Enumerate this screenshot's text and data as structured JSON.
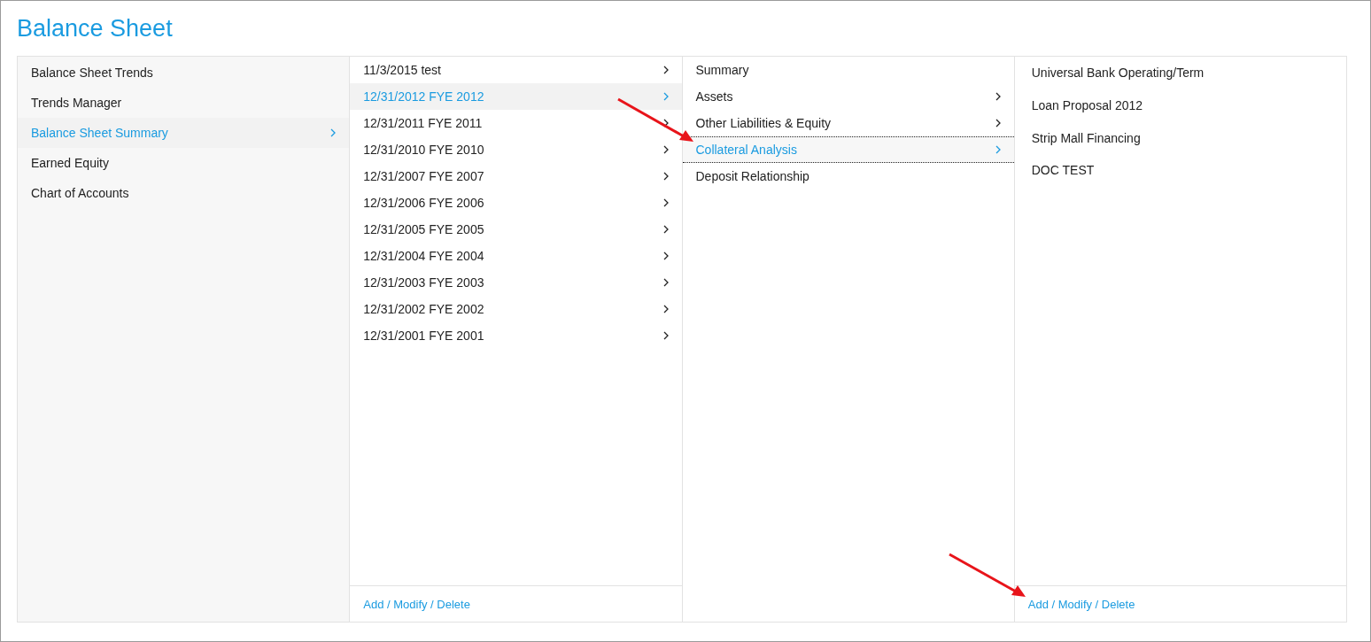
{
  "title": "Balance Sheet",
  "sidebar": {
    "items": [
      {
        "label": "Balance Sheet Trends",
        "selected": false,
        "chevron": false
      },
      {
        "label": "Trends Manager",
        "selected": false,
        "chevron": false
      },
      {
        "label": "Balance Sheet Summary",
        "selected": true,
        "chevron": true
      },
      {
        "label": "Earned Equity",
        "selected": false,
        "chevron": false
      },
      {
        "label": "Chart of Accounts",
        "selected": false,
        "chevron": false
      }
    ]
  },
  "periods": {
    "items": [
      {
        "label": "11/3/2015 test",
        "selected": false,
        "chevron": true
      },
      {
        "label": "12/31/2012 FYE 2012",
        "selected": true,
        "chevron": true
      },
      {
        "label": "12/31/2011 FYE 2011",
        "selected": false,
        "chevron": true
      },
      {
        "label": "12/31/2010 FYE 2010",
        "selected": false,
        "chevron": true
      },
      {
        "label": "12/31/2007 FYE 2007",
        "selected": false,
        "chevron": true
      },
      {
        "label": "12/31/2006 FYE 2006",
        "selected": false,
        "chevron": true
      },
      {
        "label": "12/31/2005 FYE 2005",
        "selected": false,
        "chevron": true
      },
      {
        "label": "12/31/2004 FYE 2004",
        "selected": false,
        "chevron": true
      },
      {
        "label": "12/31/2003 FYE 2003",
        "selected": false,
        "chevron": true
      },
      {
        "label": "12/31/2002 FYE 2002",
        "selected": false,
        "chevron": true
      },
      {
        "label": "12/31/2001 FYE 2001",
        "selected": false,
        "chevron": true
      }
    ],
    "footer_link": "Add / Modify / Delete"
  },
  "sections": {
    "items": [
      {
        "label": "Summary",
        "selected": false,
        "chevron": false
      },
      {
        "label": "Assets",
        "selected": false,
        "chevron": true
      },
      {
        "label": "Other Liabilities & Equity",
        "selected": false,
        "chevron": true
      },
      {
        "label": "Collateral Analysis",
        "selected": true,
        "chevron": true
      },
      {
        "label": "Deposit Relationship",
        "selected": false,
        "chevron": false
      }
    ]
  },
  "documents": {
    "items": [
      {
        "label": "Universal Bank Operating/Term",
        "selected": false
      },
      {
        "label": "Loan Proposal 2012",
        "selected": false
      },
      {
        "label": "Strip Mall Financing",
        "selected": false
      },
      {
        "label": "DOC TEST",
        "selected": false
      }
    ],
    "footer_link": "Add / Modify / Delete"
  }
}
